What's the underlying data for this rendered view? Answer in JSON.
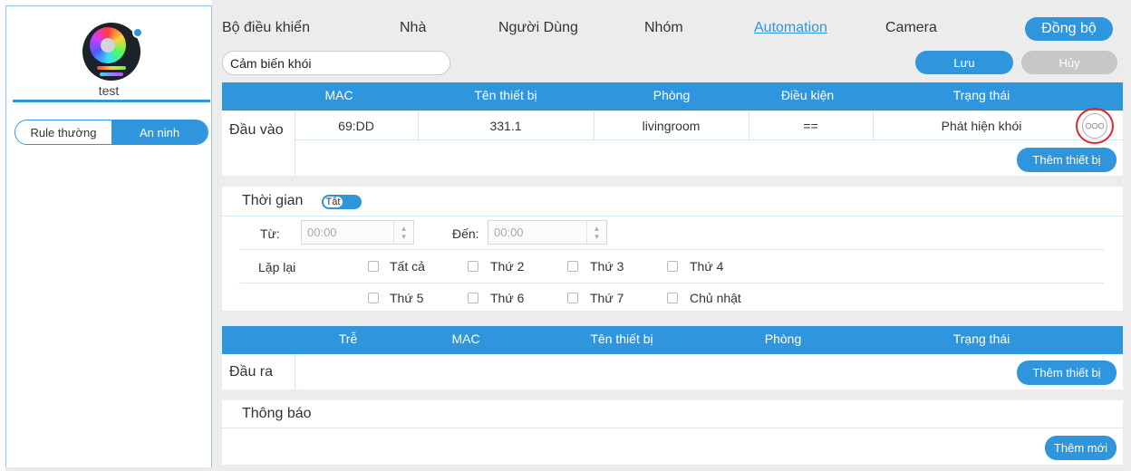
{
  "user": {
    "name": "test"
  },
  "rule_tabs": {
    "normal": "Rule thường",
    "security": "An ninh"
  },
  "nav": {
    "items": [
      "Bộ điều khiển",
      "Nhà",
      "Người Dùng",
      "Nhóm",
      "Automation",
      "Camera"
    ],
    "active": "Automation",
    "sync_label": "Đồng bộ"
  },
  "rule": {
    "name": "Cảm biến khói",
    "save_label": "Lưu",
    "cancel_label": "Hủy"
  },
  "input": {
    "section_label": "Đầu vào",
    "columns": [
      "MAC",
      "Tên thiết bị",
      "Phòng",
      "Điều kiện",
      "Trạng thái"
    ],
    "rows": [
      {
        "mac": "69:DD",
        "device": "331.1",
        "room": "livingroom",
        "condition": "==",
        "status": "Phát hiện khói"
      }
    ],
    "add_label": "Thêm thiết bị"
  },
  "time": {
    "section_label": "Thời gian",
    "toggle_label": "Tắt",
    "from_label": "Từ:",
    "from_value": "00:00",
    "to_label": "Đến:",
    "to_value": "00:00",
    "repeat_label": "Lặp lại",
    "days": [
      "Tất cả",
      "Thứ 2",
      "Thứ 3",
      "Thứ 4",
      "Thứ 5",
      "Thứ 6",
      "Thứ 7",
      "Chủ nhật"
    ]
  },
  "output": {
    "section_label": "Đầu ra",
    "columns": [
      "Trễ",
      "MAC",
      "Tên thiết bị",
      "Phòng",
      "Trạng thái"
    ],
    "add_label": "Thêm thiết bị"
  },
  "notification": {
    "section_label": "Thông báo",
    "add_label": "Thêm mới"
  },
  "colors": {
    "accent": "#2f95dc",
    "highlight_circle": "#e0262d",
    "background": "#ececec"
  }
}
